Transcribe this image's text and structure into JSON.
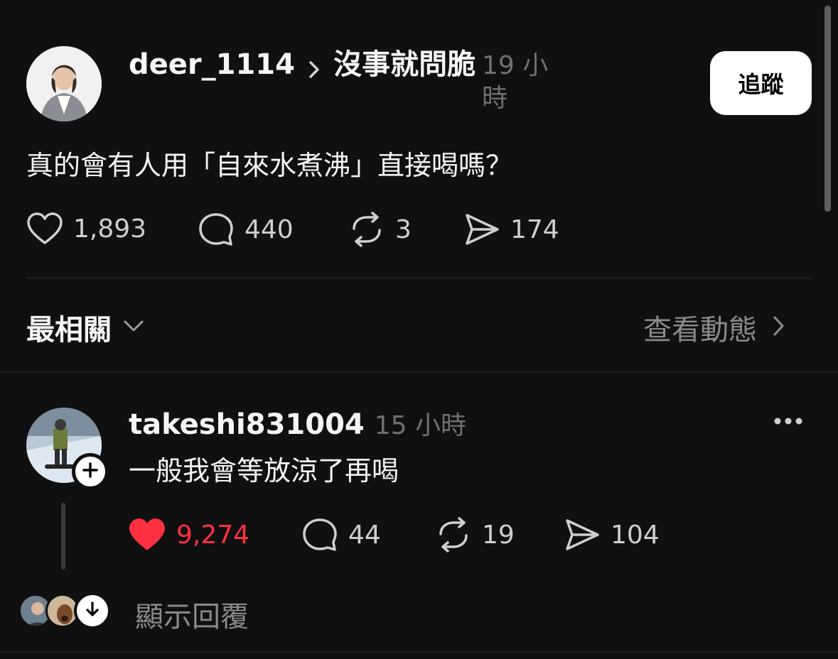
{
  "post": {
    "username": "deer_1114",
    "community": "沒事就問脆",
    "time": "19 小時",
    "follow_label": "追蹤",
    "text": "真的會有人用「自來水煮沸」直接喝嗎？",
    "stats": {
      "likes": "1,893",
      "comments": "440",
      "reposts": "3",
      "shares": "174"
    }
  },
  "filter": {
    "sort_label": "最相關",
    "activity_label": "查看動態"
  },
  "reply": {
    "username": "takeshi831004",
    "time": "15 小時",
    "text": "一般我會等放涼了再喝",
    "stats": {
      "likes": "9,274",
      "comments": "44",
      "reposts": "19",
      "shares": "104"
    },
    "liked": true,
    "show_replies_label": "顯示回覆"
  },
  "colors": {
    "background": "#101010",
    "like_red": "#ff3040",
    "muted": "#777777"
  }
}
